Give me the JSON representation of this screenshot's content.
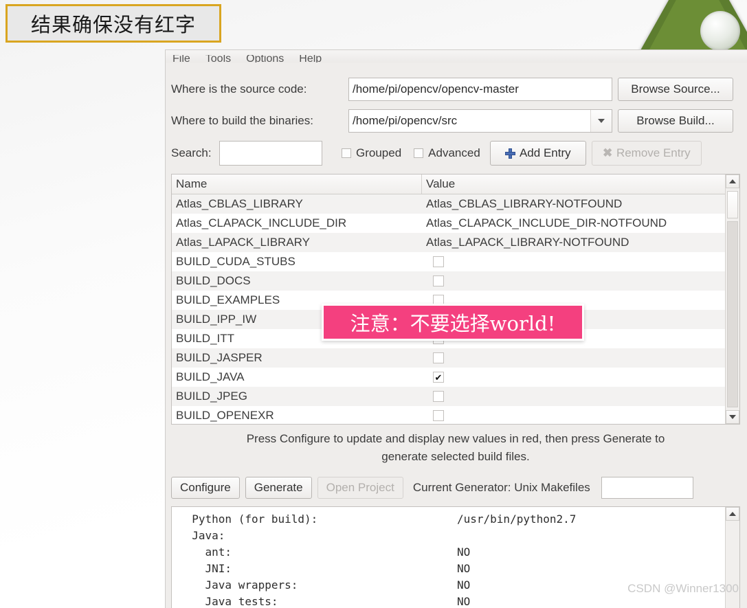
{
  "annotations": {
    "top_note": "结果确保没有红字",
    "pink_note": "注意：不要选择world!"
  },
  "watermark": "CSDN @Winner1300",
  "window": {
    "menu": [
      "File",
      "Tools",
      "Options",
      "Help"
    ],
    "fields": {
      "source_label": "Where is the source code:",
      "source_value": "/home/pi/opencv/opencv-master",
      "browse_source_label": "Browse Source...",
      "build_label": "Where to build the binaries:",
      "build_value": "/home/pi/opencv/src",
      "browse_build_label": "Browse Build...",
      "search_label": "Search:",
      "search_value": "",
      "grouped_label": "Grouped",
      "advanced_label": "Advanced",
      "add_entry_label": "Add Entry",
      "remove_entry_label": "Remove Entry"
    },
    "table": {
      "columns": [
        "Name",
        "Value"
      ],
      "rows": [
        {
          "name": "Atlas_CBLAS_LIBRARY",
          "type": "text",
          "value": "Atlas_CBLAS_LIBRARY-NOTFOUND"
        },
        {
          "name": "Atlas_CLAPACK_INCLUDE_DIR",
          "type": "text",
          "value": "Atlas_CLAPACK_INCLUDE_DIR-NOTFOUND"
        },
        {
          "name": "Atlas_LAPACK_LIBRARY",
          "type": "text",
          "value": "Atlas_LAPACK_LIBRARY-NOTFOUND"
        },
        {
          "name": "BUILD_CUDA_STUBS",
          "type": "checkbox",
          "checked": false
        },
        {
          "name": "BUILD_DOCS",
          "type": "checkbox",
          "checked": false
        },
        {
          "name": "BUILD_EXAMPLES",
          "type": "checkbox",
          "checked": false
        },
        {
          "name": "BUILD_IPP_IW",
          "type": "checkbox",
          "checked": false
        },
        {
          "name": "BUILD_ITT",
          "type": "checkbox",
          "checked": false
        },
        {
          "name": "BUILD_JASPER",
          "type": "checkbox",
          "checked": false
        },
        {
          "name": "BUILD_JAVA",
          "type": "checkbox",
          "checked": true
        },
        {
          "name": "BUILD_JPEG",
          "type": "checkbox",
          "checked": false
        },
        {
          "name": "BUILD_OPENEXR",
          "type": "checkbox",
          "checked": false
        }
      ]
    },
    "hint_line1": "Press Configure to update and display new values in red, then press Generate to",
    "hint_line2": "generate selected build files.",
    "actions": {
      "configure_label": "Configure",
      "generate_label": "Generate",
      "open_project_label": "Open Project",
      "current_generator_label": "Current Generator: Unix Makefiles",
      "generator_field_value": ""
    },
    "console": {
      "lines": [
        {
          "key": "  Python (for build):",
          "value": "/usr/bin/python2.7"
        },
        {
          "key": "",
          "value": ""
        },
        {
          "key": "  Java:",
          "value": ""
        },
        {
          "key": "    ant:",
          "value": "NO"
        },
        {
          "key": "    JNI:",
          "value": "NO"
        },
        {
          "key": "    Java wrappers:",
          "value": "NO"
        },
        {
          "key": "    Java tests:",
          "value": "NO"
        }
      ]
    }
  },
  "colors": {
    "annotation_border": "#d9a520",
    "pink_banner": "#f4407f",
    "logo_green": "#5d7d2f",
    "window_bg": "#efedeb"
  }
}
